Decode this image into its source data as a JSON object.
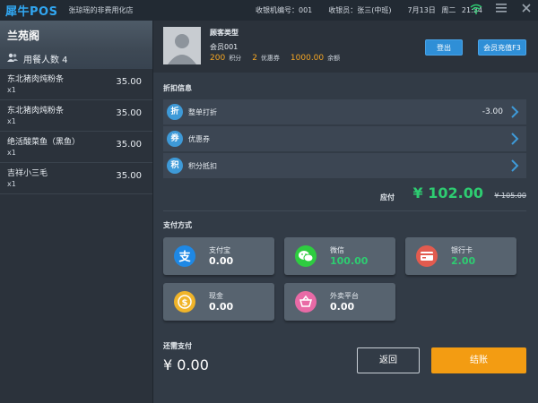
{
  "topbar": {
    "brand": "犀牛POS",
    "store": "张琼瑶的非费用化店",
    "terminal": "收银机编号：001",
    "cashier": "收银员：张三(中班)",
    "date": "7月13日",
    "weekday": "周二",
    "time": "21:34",
    "icons": [
      "wifi-icon",
      "menu-icon",
      "close-icon"
    ]
  },
  "table": {
    "name": "兰苑阁",
    "guests": "用餐人数 4"
  },
  "orders": [
    {
      "name": "东北猪肉炖粉条",
      "qty": "x1",
      "price": "35.00"
    },
    {
      "name": "东北猪肉炖粉条",
      "qty": "x1",
      "price": "35.00"
    },
    {
      "name": "绝活酸菜鱼（黑鱼）",
      "qty": "x1",
      "price": "35.00"
    },
    {
      "name": "吉祥小三毛",
      "qty": "x1",
      "price": "35.00"
    }
  ],
  "customer": {
    "type_label": "顾客类型",
    "id": "会员001",
    "points_value": "200",
    "points_label": "积分",
    "coupons_value": "2",
    "coupons_label": "优惠券",
    "balance_value": "1000.00",
    "balance_label": "余额",
    "logout_label": "登出",
    "recharge_label": "会员充值F3"
  },
  "discount": {
    "title": "折扣信息",
    "rows": [
      {
        "icon": "折",
        "label": "整单打折",
        "value": "-3.00"
      },
      {
        "icon": "券",
        "label": "优惠券",
        "value": ""
      },
      {
        "icon": "积",
        "label": "积分抵扣",
        "value": ""
      }
    ]
  },
  "due": {
    "label": "应付",
    "amount": "¥ 102.00",
    "original": "¥ 105.00"
  },
  "payment": {
    "title": "支付方式",
    "methods": [
      {
        "name": "支付宝",
        "amount": "0.00",
        "color": "#1e88e5",
        "icon": "alipay-icon"
      },
      {
        "name": "微信",
        "amount": "100.00",
        "color": "#2ecc40",
        "icon": "wechat-icon"
      },
      {
        "name": "银行卡",
        "amount": "2.00",
        "color": "#e25b4f",
        "icon": "bank-card-icon"
      },
      {
        "name": "现金",
        "amount": "0.00",
        "color": "#f0b429",
        "icon": "cash-icon"
      },
      {
        "name": "外卖平台",
        "amount": "0.00",
        "color": "#e96aa6",
        "icon": "delivery-platform-icon"
      }
    ]
  },
  "remain": {
    "label": "还需支付",
    "amount": "¥ 0.00"
  },
  "actions": {
    "back_label": "返回",
    "checkout_label": "结账"
  }
}
